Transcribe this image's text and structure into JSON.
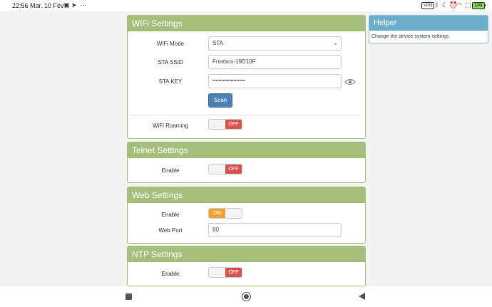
{
  "statusbar": {
    "time": "22:56",
    "date": "Mar. 10 Fév",
    "right_box": "VPN",
    "battery": "100"
  },
  "wifi": {
    "title": "WiFi Settings",
    "mode_label": "WiFi Mode",
    "mode_value": "STA",
    "ssid_label": "STA SSID",
    "ssid_value": "Freebox-19D10F",
    "key_label": "STA KEY",
    "key_value": "••••••••••••••••••••••",
    "scan_label": "Scan",
    "roaming_label": "WiFi Roaming",
    "roaming_state": "OFF"
  },
  "telnet": {
    "title": "Telnet Settings",
    "enable_label": "Enable",
    "enable_state": "OFF"
  },
  "web": {
    "title": "Web Settings",
    "enable_label": "Enable",
    "enable_state": "ON",
    "port_label": "Web Port",
    "port_value": "80"
  },
  "ntp": {
    "title": "NTP Settings",
    "enable_label": "Enable",
    "enable_state": "OFF"
  },
  "helper": {
    "title": "Helper",
    "text": "Change the device system settings"
  },
  "colors": {
    "panel_header": "#a3bf7b",
    "helper_header": "#6aaec9",
    "toggle_off": "#d9534f",
    "toggle_on": "#f0a23a",
    "scan_button": "#4e81b1"
  }
}
